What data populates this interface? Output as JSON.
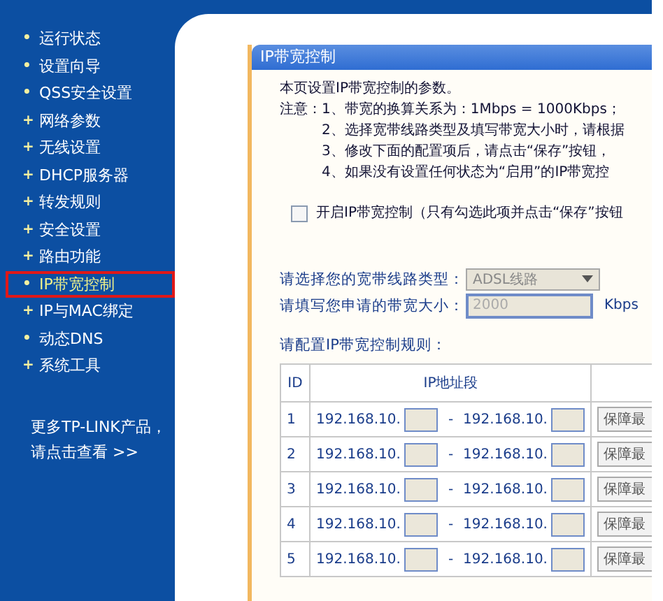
{
  "sidebar": {
    "items": [
      {
        "label": "运行状态",
        "marker": "•",
        "selected": false
      },
      {
        "label": "设置向导",
        "marker": "•",
        "selected": false
      },
      {
        "label": "QSS安全设置",
        "marker": "•",
        "selected": false
      },
      {
        "label": "网络参数",
        "marker": "+",
        "selected": false
      },
      {
        "label": "无线设置",
        "marker": "+",
        "selected": false
      },
      {
        "label": "DHCP服务器",
        "marker": "+",
        "selected": false
      },
      {
        "label": "转发规则",
        "marker": "+",
        "selected": false
      },
      {
        "label": "安全设置",
        "marker": "+",
        "selected": false
      },
      {
        "label": "路由功能",
        "marker": "+",
        "selected": false
      },
      {
        "label": "IP带宽控制",
        "marker": "•",
        "selected": true
      },
      {
        "label": "IP与MAC绑定",
        "marker": "+",
        "selected": false
      },
      {
        "label": "动态DNS",
        "marker": "•",
        "selected": false
      },
      {
        "label": "系统工具",
        "marker": "+",
        "selected": false
      }
    ],
    "more_lines": [
      "更多TP-LINK产品，",
      "请点击查看 >>"
    ]
  },
  "panel": {
    "title": "IP带宽控制",
    "intro": "本页设置IP带宽控制的参数。",
    "note_label": "注意：",
    "notes": [
      "1、带宽的换算关系为：1Mbps = 1000Kbps；",
      "2、选择宽带线路类型及填写带宽大小时，请根据",
      "3、修改下面的配置项后，请点击“保存”按钮，",
      "4、如果没有设置任何状态为“启用”的IP带宽控"
    ],
    "enable": {
      "label": "开启IP带宽控制（只有勾选此项并点击“保存”按钮",
      "checked": false
    },
    "line_type": {
      "label": "请选择您的宽带线路类型：",
      "value": "ADSL线路"
    },
    "bandwidth": {
      "label": "请填写您申请的带宽大小：",
      "value": "2000",
      "unit": "Kbps"
    },
    "rules_label": "请配置IP带宽控制规则：",
    "table": {
      "columns": [
        "ID",
        "IP地址段"
      ],
      "rows": [
        {
          "id": "1",
          "from_prefix": "192.168.10.",
          "separator": "-",
          "to_prefix": "192.168.10.",
          "mode": "保障最"
        },
        {
          "id": "2",
          "from_prefix": "192.168.10.",
          "separator": "-",
          "to_prefix": "192.168.10.",
          "mode": "保障最"
        },
        {
          "id": "3",
          "from_prefix": "192.168.10.",
          "separator": "-",
          "to_prefix": "192.168.10.",
          "mode": "保障最"
        },
        {
          "id": "4",
          "from_prefix": "192.168.10.",
          "separator": "-",
          "to_prefix": "192.168.10.",
          "mode": "保障最"
        },
        {
          "id": "5",
          "from_prefix": "192.168.10.",
          "separator": "-",
          "to_prefix": "192.168.10.",
          "mode": "保障最"
        }
      ]
    }
  }
}
